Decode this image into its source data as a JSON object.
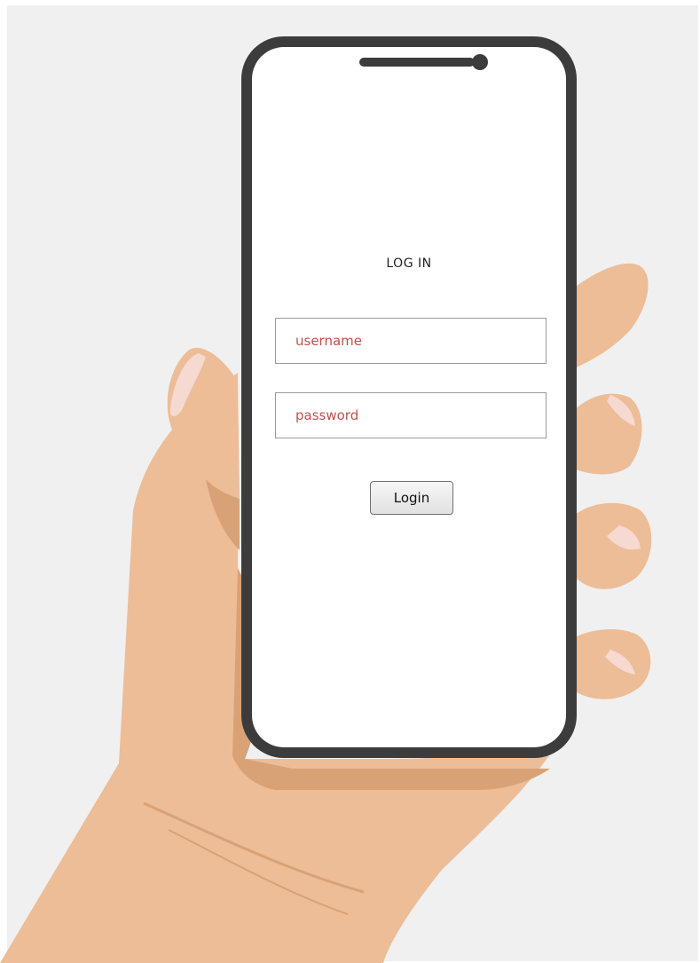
{
  "login_form": {
    "title": "LOG IN",
    "username_placeholder": "username",
    "password_placeholder": "password",
    "login_label": "Login"
  },
  "colors": {
    "backdrop": "#f0f0f0",
    "skin": "#ecbd97",
    "skin_shadow": "#d9a276",
    "nail": "#f6d9d0",
    "phone_frame": "#3c3c3c",
    "screen": "#ffffff",
    "placeholder_text": "#c0504d"
  },
  "icons": {
    "hand": "hand-illustration",
    "phone": "smartphone-frame",
    "speaker": "speaker-grille",
    "camera": "front-camera-dot"
  }
}
